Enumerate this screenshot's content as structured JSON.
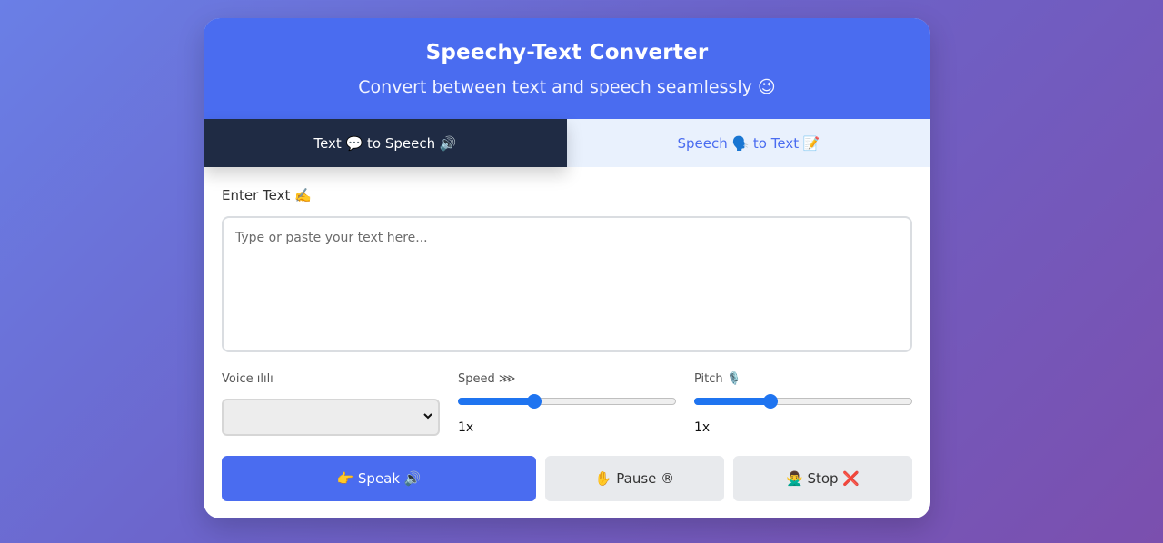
{
  "header": {
    "title": "Speechy-Text Converter",
    "subtitle": "Convert between text and speech seamlessly 😉"
  },
  "tabs": [
    {
      "label": "Text 💬 to Speech 🔊",
      "active": true
    },
    {
      "label": "Speech 🗣️ to Text 📝",
      "active": false
    }
  ],
  "text_input": {
    "label": "Enter Text ✍️",
    "placeholder": "Type or paste your text here...",
    "value": ""
  },
  "controls": {
    "voice": {
      "label": "Voice ılılı",
      "selected": ""
    },
    "speed": {
      "label": "Speed ⋙",
      "value_text": "1x",
      "fraction": 0.35
    },
    "pitch": {
      "label": "Pitch 🎙️",
      "value_text": "1x",
      "fraction": 0.35
    }
  },
  "buttons": {
    "speak": "👉 Speak 🔊",
    "pause": "✋ Pause ®",
    "stop": "🙅‍♂️ Stop ❌"
  },
  "colors": {
    "accent": "#4a6cf0",
    "tab_active_bg": "#1f2b44",
    "tab_inactive_bg": "#e9f1fd",
    "slider": "#1f74f0"
  }
}
